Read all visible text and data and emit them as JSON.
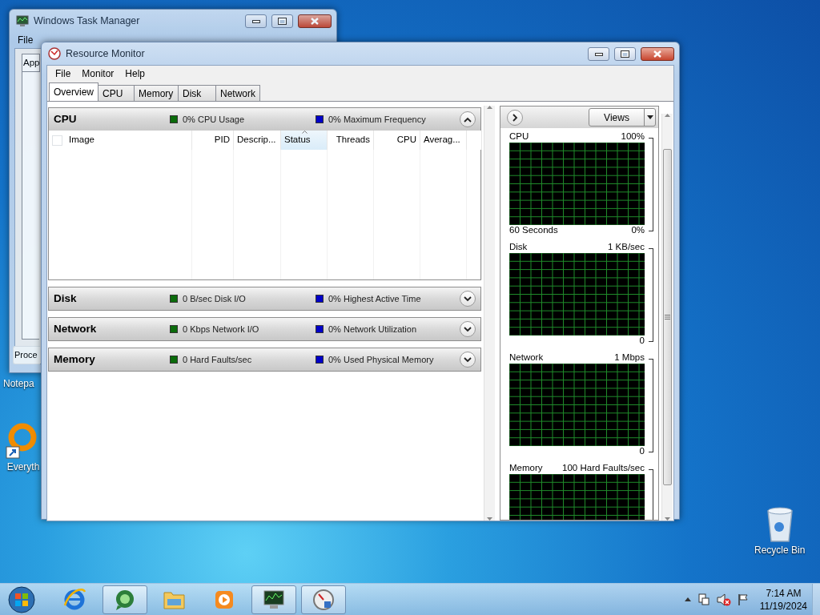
{
  "desktop": {
    "icons": [
      {
        "kind": "notepad",
        "label": "Notepa"
      },
      {
        "kind": "everything",
        "label": "Everyth"
      },
      {
        "kind": "recycle",
        "label": "Recycle Bin"
      }
    ]
  },
  "task_manager": {
    "title": "Windows Task Manager",
    "menu": [
      "File"
    ],
    "tab": "App",
    "button": "Proce"
  },
  "resource_monitor": {
    "title": "Resource Monitor",
    "menu": [
      "File",
      "Monitor",
      "Help"
    ],
    "tabs": [
      {
        "label": "Overview",
        "selected": true
      },
      {
        "label": "CPU",
        "selected": false
      },
      {
        "label": "Memory",
        "selected": false
      },
      {
        "label": "Disk",
        "selected": false
      },
      {
        "label": "Network",
        "selected": false
      }
    ],
    "sections": [
      {
        "title": "CPU",
        "expanded": true,
        "metric_1": "0% CPU Usage",
        "metric_2": "0% Maximum Frequency",
        "table": {
          "select_all_checked": false,
          "columns": [
            {
              "label": "Image",
              "sorted": false
            },
            {
              "label": "PID",
              "sorted": false
            },
            {
              "label": "Descrip...",
              "sorted": false
            },
            {
              "label": "Status",
              "sorted": true
            },
            {
              "label": "Threads",
              "sorted": false
            },
            {
              "label": "CPU",
              "sorted": false
            },
            {
              "label": "Averag...",
              "sorted": false
            }
          ]
        }
      },
      {
        "title": "Disk",
        "expanded": false,
        "metric_1": "0 B/sec Disk I/O",
        "metric_2": "0% Highest Active Time"
      },
      {
        "title": "Network",
        "expanded": false,
        "metric_1": "0 Kbps Network I/O",
        "metric_2": "0% Network Utilization"
      },
      {
        "title": "Memory",
        "expanded": false,
        "metric_1": "0 Hard Faults/sec",
        "metric_2": "0% Used Physical Memory"
      }
    ],
    "graph_panel": {
      "views_button": "Views",
      "graphs": [
        {
          "title": "CPU",
          "scale_max": "100%",
          "footer": "60 Seconds",
          "scale_min": "0%"
        },
        {
          "title": "Disk",
          "scale_max": "1 KB/sec",
          "scale_min": "0"
        },
        {
          "title": "Network",
          "scale_max": "1 Mbps",
          "scale_min": "0"
        },
        {
          "title": "Memory",
          "scale_max": "100 Hard Faults/sec"
        }
      ]
    }
  },
  "taskbar": {
    "items": [
      {
        "kind": "browser",
        "active": false
      },
      {
        "kind": "chat",
        "active": true
      },
      {
        "kind": "folder",
        "active": false
      },
      {
        "kind": "media",
        "active": false
      },
      {
        "kind": "monitor",
        "active": true
      },
      {
        "kind": "gauge",
        "active": true
      }
    ],
    "clock": {
      "time": "7:14 AM",
      "date": "11/19/2024"
    }
  }
}
